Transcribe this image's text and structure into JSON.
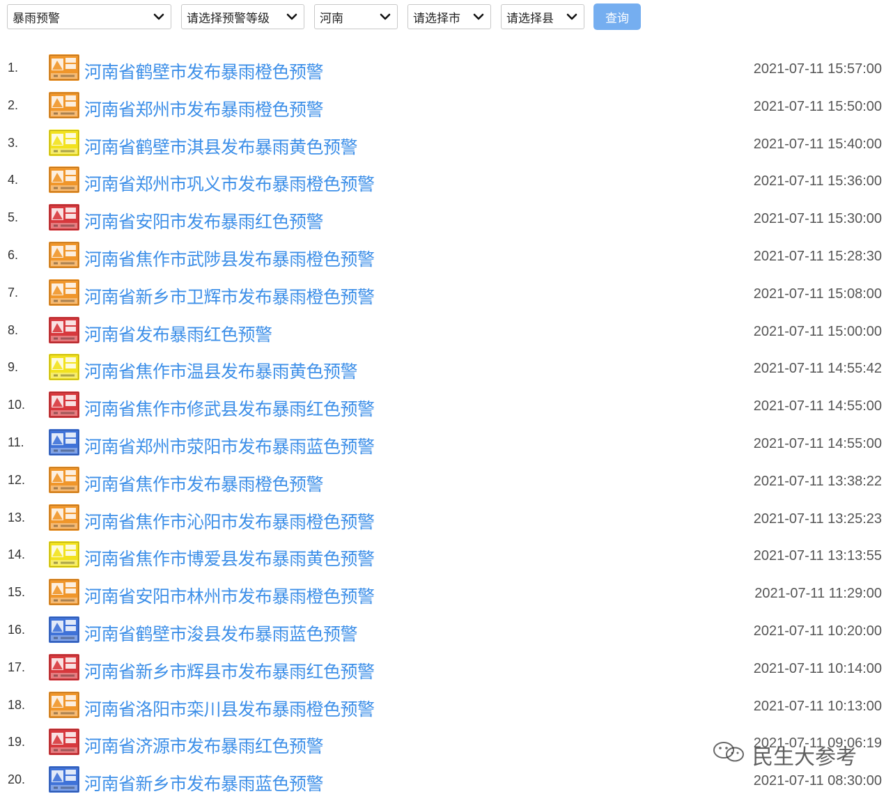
{
  "filters": {
    "type_select": "暴雨预警",
    "level_select": "请选择预警等级",
    "province_select": "河南",
    "city_select": "请选择市",
    "county_select": "请选择县",
    "query_button": "查询"
  },
  "level_colors": {
    "orange": "#f0962a",
    "yellow": "#f2e21e",
    "red": "#d7383d",
    "blue": "#3f72d8"
  },
  "alerts": [
    {
      "index": "1.",
      "level": "orange",
      "title": "河南省鹤壁市发布暴雨橙色预警",
      "time": "2021-07-11 15:57:00"
    },
    {
      "index": "2.",
      "level": "orange",
      "title": "河南省郑州市发布暴雨橙色预警",
      "time": "2021-07-11 15:50:00"
    },
    {
      "index": "3.",
      "level": "yellow",
      "title": "河南省鹤壁市淇县发布暴雨黄色预警",
      "time": "2021-07-11 15:40:00"
    },
    {
      "index": "4.",
      "level": "orange",
      "title": "河南省郑州市巩义市发布暴雨橙色预警",
      "time": "2021-07-11 15:36:00"
    },
    {
      "index": "5.",
      "level": "red",
      "title": "河南省安阳市发布暴雨红色预警",
      "time": "2021-07-11 15:30:00"
    },
    {
      "index": "6.",
      "level": "orange",
      "title": "河南省焦作市武陟县发布暴雨橙色预警",
      "time": "2021-07-11 15:28:30"
    },
    {
      "index": "7.",
      "level": "orange",
      "title": "河南省新乡市卫辉市发布暴雨橙色预警",
      "time": "2021-07-11 15:08:00"
    },
    {
      "index": "8.",
      "level": "red",
      "title": "河南省发布暴雨红色预警",
      "time": "2021-07-11 15:00:00"
    },
    {
      "index": "9.",
      "level": "yellow",
      "title": "河南省焦作市温县发布暴雨黄色预警",
      "time": "2021-07-11 14:55:42"
    },
    {
      "index": "10.",
      "level": "red",
      "title": "河南省焦作市修武县发布暴雨红色预警",
      "time": "2021-07-11 14:55:00"
    },
    {
      "index": "11.",
      "level": "blue",
      "title": "河南省郑州市荥阳市发布暴雨蓝色预警",
      "time": "2021-07-11 14:55:00"
    },
    {
      "index": "12.",
      "level": "orange",
      "title": "河南省焦作市发布暴雨橙色预警",
      "time": "2021-07-11 13:38:22"
    },
    {
      "index": "13.",
      "level": "orange",
      "title": "河南省焦作市沁阳市发布暴雨橙色预警",
      "time": "2021-07-11 13:25:23"
    },
    {
      "index": "14.",
      "level": "yellow",
      "title": "河南省焦作市博爱县发布暴雨黄色预警",
      "time": "2021-07-11 13:13:55"
    },
    {
      "index": "15.",
      "level": "orange",
      "title": "河南省安阳市林州市发布暴雨橙色预警",
      "time": "2021-07-11 11:29:00"
    },
    {
      "index": "16.",
      "level": "blue",
      "title": "河南省鹤壁市浚县发布暴雨蓝色预警",
      "time": "2021-07-11 10:20:00"
    },
    {
      "index": "17.",
      "level": "red",
      "title": "河南省新乡市辉县市发布暴雨红色预警",
      "time": "2021-07-11 10:14:00"
    },
    {
      "index": "18.",
      "level": "orange",
      "title": "河南省洛阳市栾川县发布暴雨橙色预警",
      "time": "2021-07-11 10:13:00"
    },
    {
      "index": "19.",
      "level": "red",
      "title": "河南省济源市发布暴雨红色预警",
      "time": "2021-07-11 09:06:19"
    },
    {
      "index": "20.",
      "level": "blue",
      "title": "河南省新乡市发布暴雨蓝色预警",
      "time": "2021-07-11 08:30:00"
    }
  ],
  "watermark": {
    "text": "民生大参考",
    "icon": "wechat-icon"
  }
}
